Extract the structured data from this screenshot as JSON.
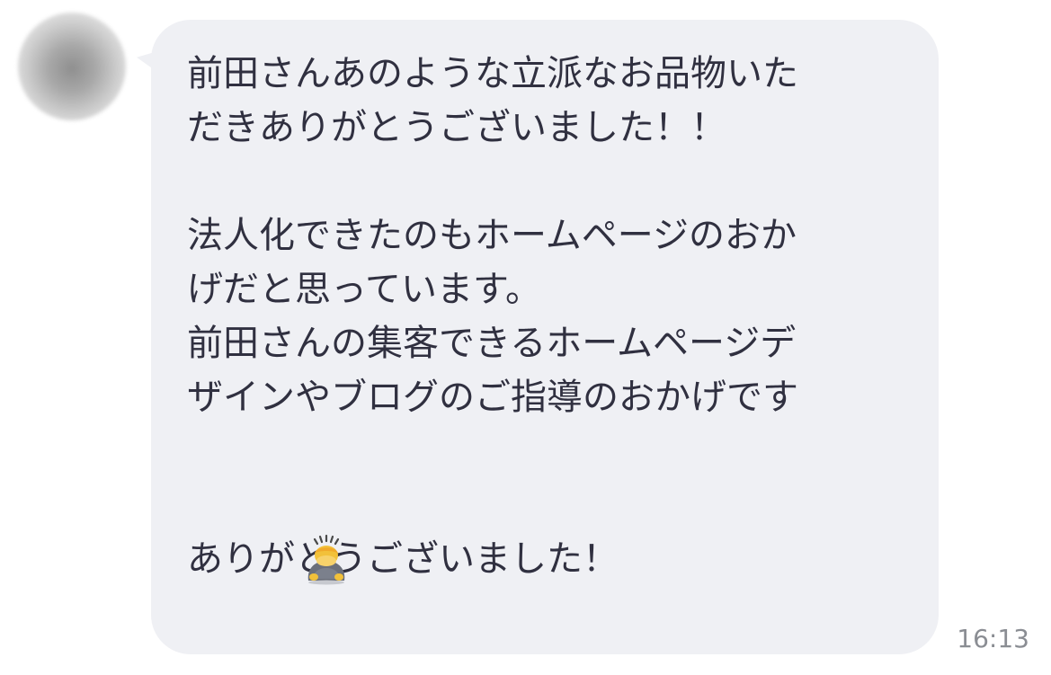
{
  "message": {
    "lines": [
      "前田さんあのような立派なお品物いた",
      "だきありがとうございました！！",
      "",
      "法人化できたのもホームページのおか",
      "げだと思っています。",
      "前田さんの集客できるホームページデ",
      "ザインやブログのご指導のおかげです",
      "",
      "",
      "ありがとうございました！"
    ],
    "emoji": "deep-bow-emoji",
    "timestamp": "16:13"
  }
}
